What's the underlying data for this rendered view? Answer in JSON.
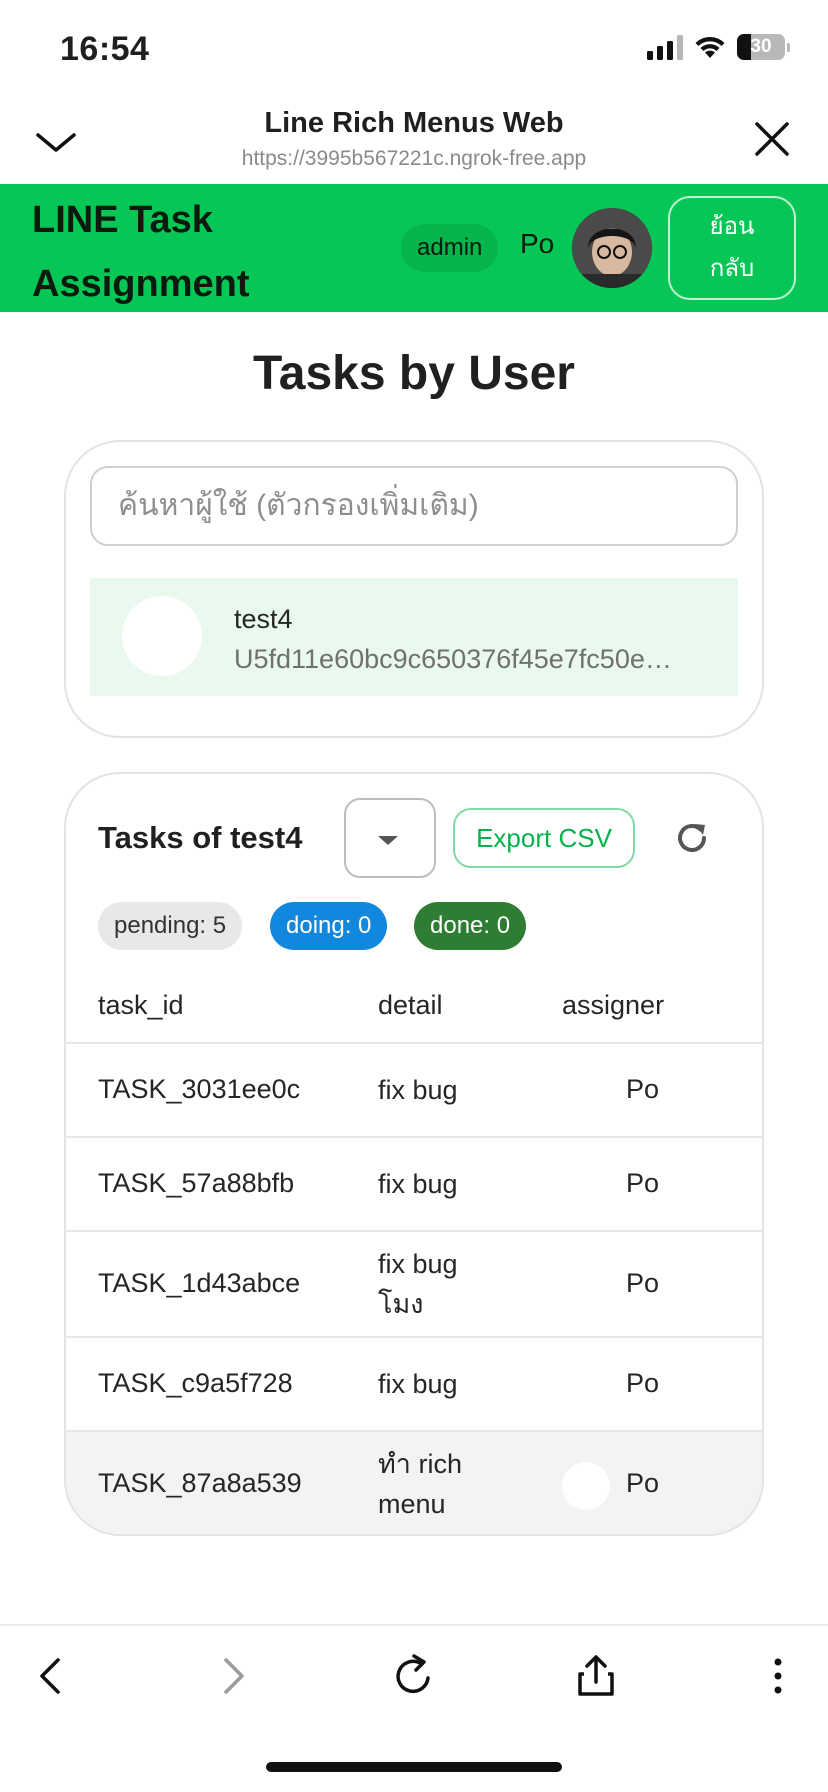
{
  "status_bar": {
    "time": "16:54",
    "battery": "30"
  },
  "browser": {
    "title": "Line Rich Menus Web",
    "url": "https://3995b567221c.ngrok-free.app"
  },
  "app_header": {
    "title": "LINE Task Assignment",
    "role": "admin",
    "user": "Po",
    "back_label_1": "ย้อน",
    "back_label_2": "กลับ",
    "brand_color": "#06c755"
  },
  "page": {
    "title": "Tasks by User"
  },
  "user_search": {
    "placeholder": "ค้นหาผู้ใช้ (ตัวกรองเพิ่มเติม)",
    "value": "",
    "results": [
      {
        "name": "test4",
        "user_id": "U5fd11e60bc9c650376f45e7fc50e…"
      }
    ]
  },
  "tasks_panel": {
    "title": "Tasks of test4",
    "status_filter": "",
    "export_label": "Export CSV",
    "counts": {
      "pending": "pending: 5",
      "doing": "doing: 0",
      "done": "done: 0"
    },
    "columns": {
      "task_id": "task_id",
      "detail": "detail",
      "assigner": "assigner"
    },
    "rows": [
      {
        "task_id": "TASK_3031ee0c",
        "detail": "fix bug",
        "assigner": "Po"
      },
      {
        "task_id": "TASK_57a88bfb",
        "detail": "fix bug",
        "assigner": "Po"
      },
      {
        "task_id": "TASK_1d43abce",
        "detail": "fix bug โมง",
        "assigner": "Po"
      },
      {
        "task_id": "TASK_c9a5f728",
        "detail": "fix bug",
        "assigner": "Po"
      },
      {
        "task_id": "TASK_87a8a539",
        "detail": "ทำ rich menu",
        "assigner": "Po"
      }
    ]
  },
  "toolbar": {
    "icons": [
      "back-icon",
      "forward-icon",
      "reload-icon",
      "share-icon",
      "more-icon"
    ]
  }
}
